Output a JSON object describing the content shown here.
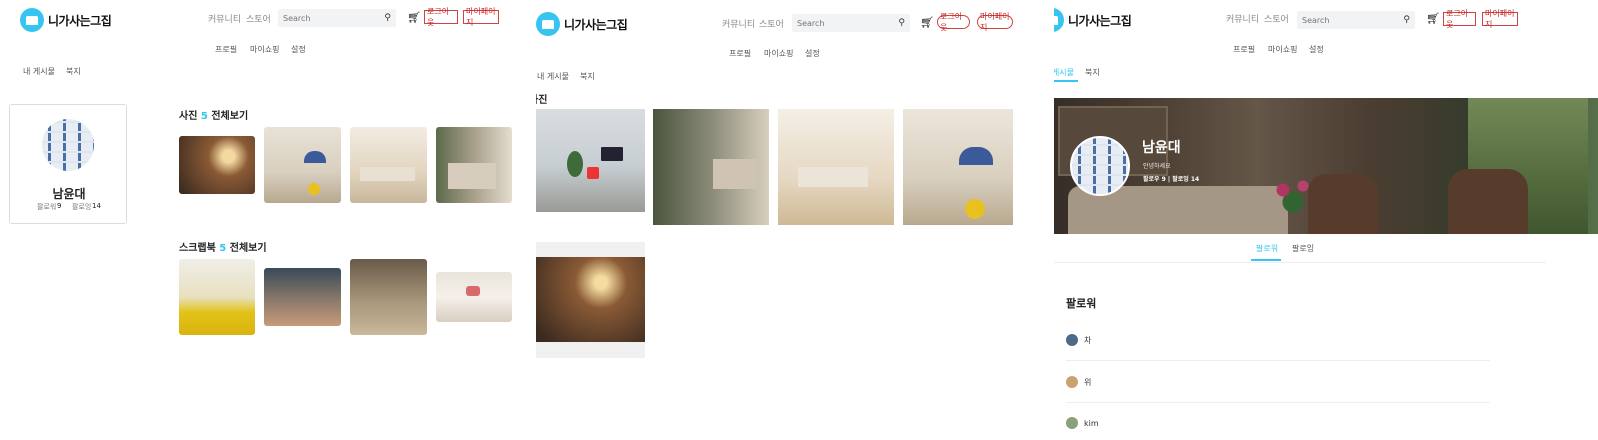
{
  "brand": {
    "name": "니가사는그집"
  },
  "nav": {
    "community": "커뮤니티",
    "store": "스토어",
    "search_placeholder": "Search",
    "logout": "로그아웃",
    "mypage": "마이페이지",
    "sub": [
      "프로필",
      "마이쇼핑",
      "설정"
    ]
  },
  "tabs": [
    "내 게시물",
    "북지"
  ],
  "profile": {
    "name": "남윤대",
    "followers_label": "팔로워",
    "followers": "9",
    "following_label": "팔로잉",
    "following": "14",
    "bio": "안녕하세요",
    "stats_line": "팔로우 9 | 팔로잉 14"
  },
  "sections": {
    "photos": {
      "title": "사진",
      "count": "5",
      "all": "전체보기"
    },
    "scrapbook": {
      "title": "스크랩북",
      "count": "5",
      "all": "전체보기"
    },
    "photos_only_title": "사진"
  },
  "follow_tabs": [
    "팔로워",
    "팔로잉"
  ],
  "followers_heading": "팔로워",
  "followers_list": [
    {
      "name": "차",
      "color": "#4a6a8a"
    },
    {
      "name": "위",
      "color": "#c9a36a"
    },
    {
      "name": "kim",
      "color": "#8aa07a"
    }
  ],
  "colors": {
    "accent": "#35c5f0",
    "danger": "#c22222"
  }
}
